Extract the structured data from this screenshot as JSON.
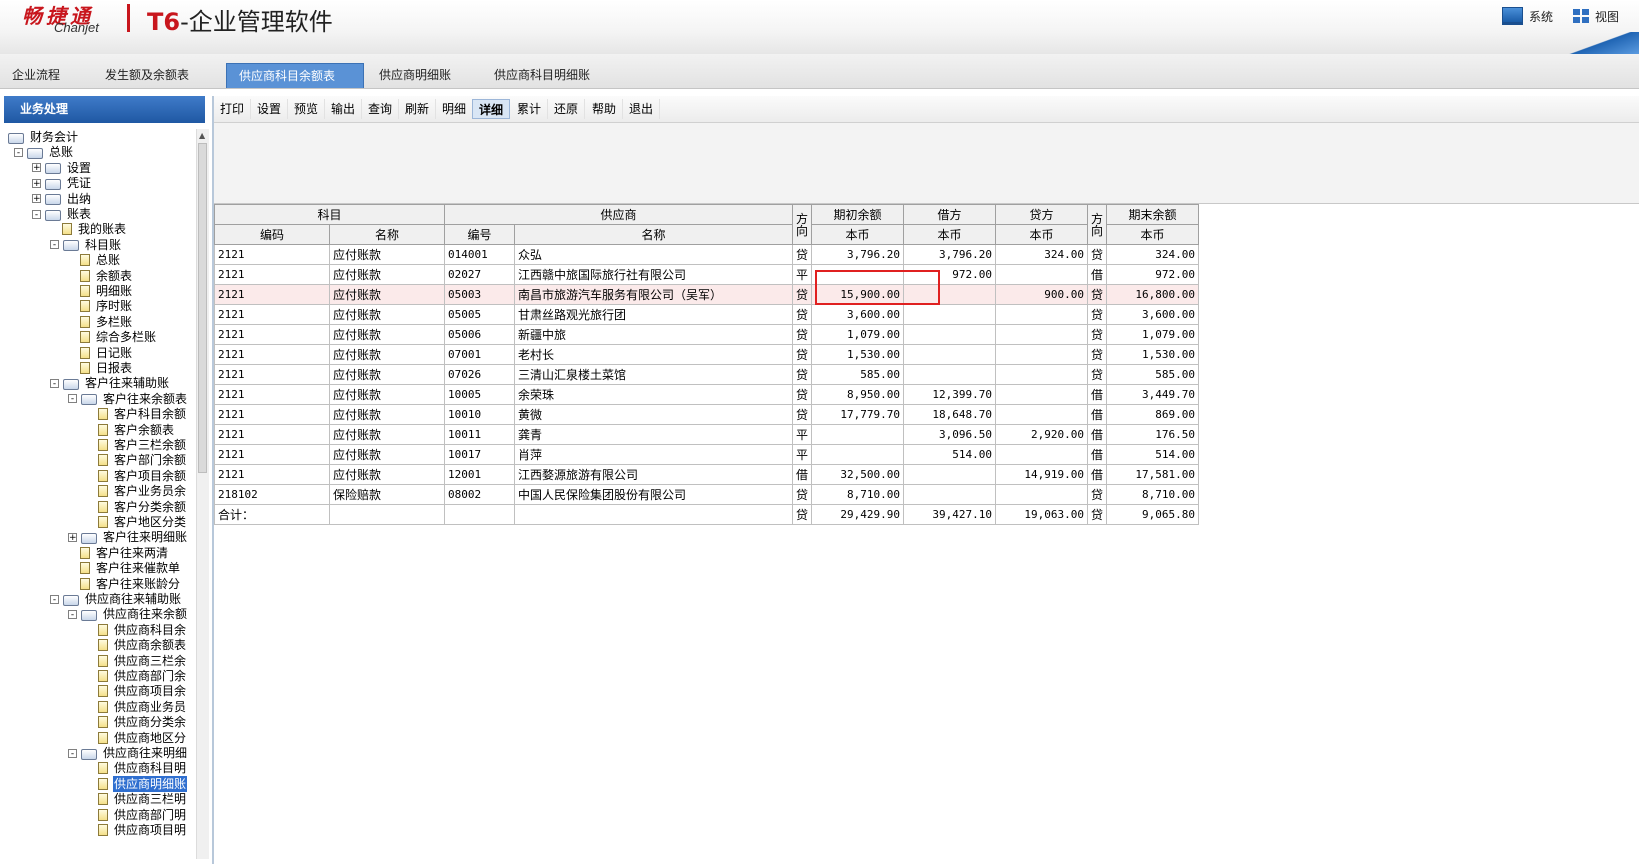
{
  "header": {
    "logo_cn": "畅捷通",
    "logo_en": "Chanjet",
    "product_t6": "T6",
    "product_rest": "-企业管理软件",
    "system_label": "系统",
    "view_label": "视图"
  },
  "tabs": [
    {
      "label": "企业流程"
    },
    {
      "label": "发生额及余额表"
    },
    {
      "label": "供应商科目余额表",
      "close": "×"
    },
    {
      "label": "供应商明细账"
    },
    {
      "label": "供应商科目明细账"
    }
  ],
  "left_panel": {
    "title": "业务处理",
    "tree": [
      {
        "label": "财务会计"
      },
      {
        "label": "总账"
      },
      {
        "label": "设置"
      },
      {
        "label": "凭证"
      },
      {
        "label": "出纳"
      },
      {
        "label": "账表"
      },
      {
        "label": "我的账表"
      },
      {
        "label": "科目账"
      },
      {
        "label": "总账"
      },
      {
        "label": "余额表"
      },
      {
        "label": "明细账"
      },
      {
        "label": "序时账"
      },
      {
        "label": "多栏账"
      },
      {
        "label": "综合多栏账"
      },
      {
        "label": "日记账"
      },
      {
        "label": "日报表"
      },
      {
        "label": "客户往来辅助账"
      },
      {
        "label": "客户往来余额表"
      },
      {
        "label": "客户科目余额"
      },
      {
        "label": "客户余额表"
      },
      {
        "label": "客户三栏余额"
      },
      {
        "label": "客户部门余额"
      },
      {
        "label": "客户项目余额"
      },
      {
        "label": "客户业务员余"
      },
      {
        "label": "客户分类余额"
      },
      {
        "label": "客户地区分类"
      },
      {
        "label": "客户往来明细账"
      },
      {
        "label": "客户往来两清"
      },
      {
        "label": "客户往来催款单"
      },
      {
        "label": "客户往来账龄分"
      },
      {
        "label": "供应商往来辅助账"
      },
      {
        "label": "供应商往来余额"
      },
      {
        "label": "供应商科目余"
      },
      {
        "label": "供应商余额表"
      },
      {
        "label": "供应商三栏余"
      },
      {
        "label": "供应商部门余"
      },
      {
        "label": "供应商项目余"
      },
      {
        "label": "供应商业务员"
      },
      {
        "label": "供应商分类余"
      },
      {
        "label": "供应商地区分"
      },
      {
        "label": "供应商往来明细"
      },
      {
        "label": "供应商科目明"
      },
      {
        "label": "供应商明细账"
      },
      {
        "label": "供应商三栏明"
      },
      {
        "label": "供应商部门明"
      },
      {
        "label": "供应商项目明"
      }
    ]
  },
  "toolbar": [
    {
      "label": "打印"
    },
    {
      "label": "设置"
    },
    {
      "label": "预览"
    },
    {
      "label": "输出"
    },
    {
      "label": "查询"
    },
    {
      "label": "刷新"
    },
    {
      "label": "明细"
    },
    {
      "label": "详细"
    },
    {
      "label": "累计"
    },
    {
      "label": "还原"
    },
    {
      "label": "帮助"
    },
    {
      "label": "退出"
    }
  ],
  "grid": {
    "group_headers": {
      "subject": "科目",
      "supplier": "供应商",
      "direction1": "方向",
      "opening": "期初余额",
      "debit": "借方",
      "credit": "贷方",
      "direction2": "方向",
      "closing": "期末余额"
    },
    "sub_headers": {
      "code": "编码",
      "name": "名称",
      "supplier_code": "编号",
      "supplier_name": "名称",
      "currency": "本币"
    },
    "rows": [
      {
        "c1": "2121",
        "c2": "应付账款",
        "c3": "014001",
        "c4": "众弘",
        "d1": "贷",
        "open": "3,796.20",
        "debit": "3,796.20",
        "credit": "324.00",
        "d2": "贷",
        "close": "324.00"
      },
      {
        "c1": "2121",
        "c2": "应付账款",
        "c3": "02027",
        "c4": "江西赣中旅国际旅行社有限公司",
        "d1": "平",
        "open": "",
        "debit": "972.00",
        "credit": "",
        "d2": "借",
        "close": "972.00"
      },
      {
        "c1": "2121",
        "c2": "应付账款",
        "c3": "05003",
        "c4": "南昌市旅游汽车服务有限公司（吴军）",
        "d1": "贷",
        "open": "15,900.00",
        "debit": "",
        "credit": "900.00",
        "d2": "贷",
        "close": "16,800.00"
      },
      {
        "c1": "2121",
        "c2": "应付账款",
        "c3": "05005",
        "c4": "甘肃丝路观光旅行团",
        "d1": "贷",
        "open": "3,600.00",
        "debit": "",
        "credit": "",
        "d2": "贷",
        "close": "3,600.00"
      },
      {
        "c1": "2121",
        "c2": "应付账款",
        "c3": "05006",
        "c4": "新疆中旅",
        "d1": "贷",
        "open": "1,079.00",
        "debit": "",
        "credit": "",
        "d2": "贷",
        "close": "1,079.00"
      },
      {
        "c1": "2121",
        "c2": "应付账款",
        "c3": "07001",
        "c4": "老村长",
        "d1": "贷",
        "open": "1,530.00",
        "debit": "",
        "credit": "",
        "d2": "贷",
        "close": "1,530.00"
      },
      {
        "c1": "2121",
        "c2": "应付账款",
        "c3": "07026",
        "c4": "三清山汇泉楼土菜馆",
        "d1": "贷",
        "open": "585.00",
        "debit": "",
        "credit": "",
        "d2": "贷",
        "close": "585.00"
      },
      {
        "c1": "2121",
        "c2": "应付账款",
        "c3": "10005",
        "c4": "余荣珠",
        "d1": "贷",
        "open": "8,950.00",
        "debit": "12,399.70",
        "credit": "",
        "d2": "借",
        "close": "3,449.70"
      },
      {
        "c1": "2121",
        "c2": "应付账款",
        "c3": "10010",
        "c4": "黄微",
        "d1": "贷",
        "open": "17,779.70",
        "debit": "18,648.70",
        "credit": "",
        "d2": "借",
        "close": "869.00"
      },
      {
        "c1": "2121",
        "c2": "应付账款",
        "c3": "10011",
        "c4": "龚青",
        "d1": "平",
        "open": "",
        "debit": "3,096.50",
        "credit": "2,920.00",
        "d2": "借",
        "close": "176.50"
      },
      {
        "c1": "2121",
        "c2": "应付账款",
        "c3": "10017",
        "c4": "肖萍",
        "d1": "平",
        "open": "",
        "debit": "514.00",
        "credit": "",
        "d2": "借",
        "close": "514.00"
      },
      {
        "c1": "2121",
        "c2": "应付账款",
        "c3": "12001",
        "c4": "江西婺源旅游有限公司",
        "d1": "借",
        "open": "32,500.00",
        "debit": "",
        "credit": "14,919.00",
        "d2": "借",
        "close": "17,581.00"
      },
      {
        "c1": "218102",
        "c2": "保险赔款",
        "c3": "08002",
        "c4": "中国人民保险集团股份有限公司",
        "d1": "贷",
        "open": "8,710.00",
        "debit": "",
        "credit": "",
        "d2": "贷",
        "close": "8,710.00"
      },
      {
        "c1": "合计：",
        "c2": "",
        "c3": "",
        "c4": "",
        "d1": "贷",
        "open": "29,429.90",
        "debit": "39,427.10",
        "credit": "19,063.00",
        "d2": "贷",
        "close": "9,065.80"
      }
    ],
    "highlight_row": 2
  },
  "colors": {
    "accent": "#2f6fd0",
    "brand_red": "#c8161d",
    "annotation_red": "#e02020"
  }
}
